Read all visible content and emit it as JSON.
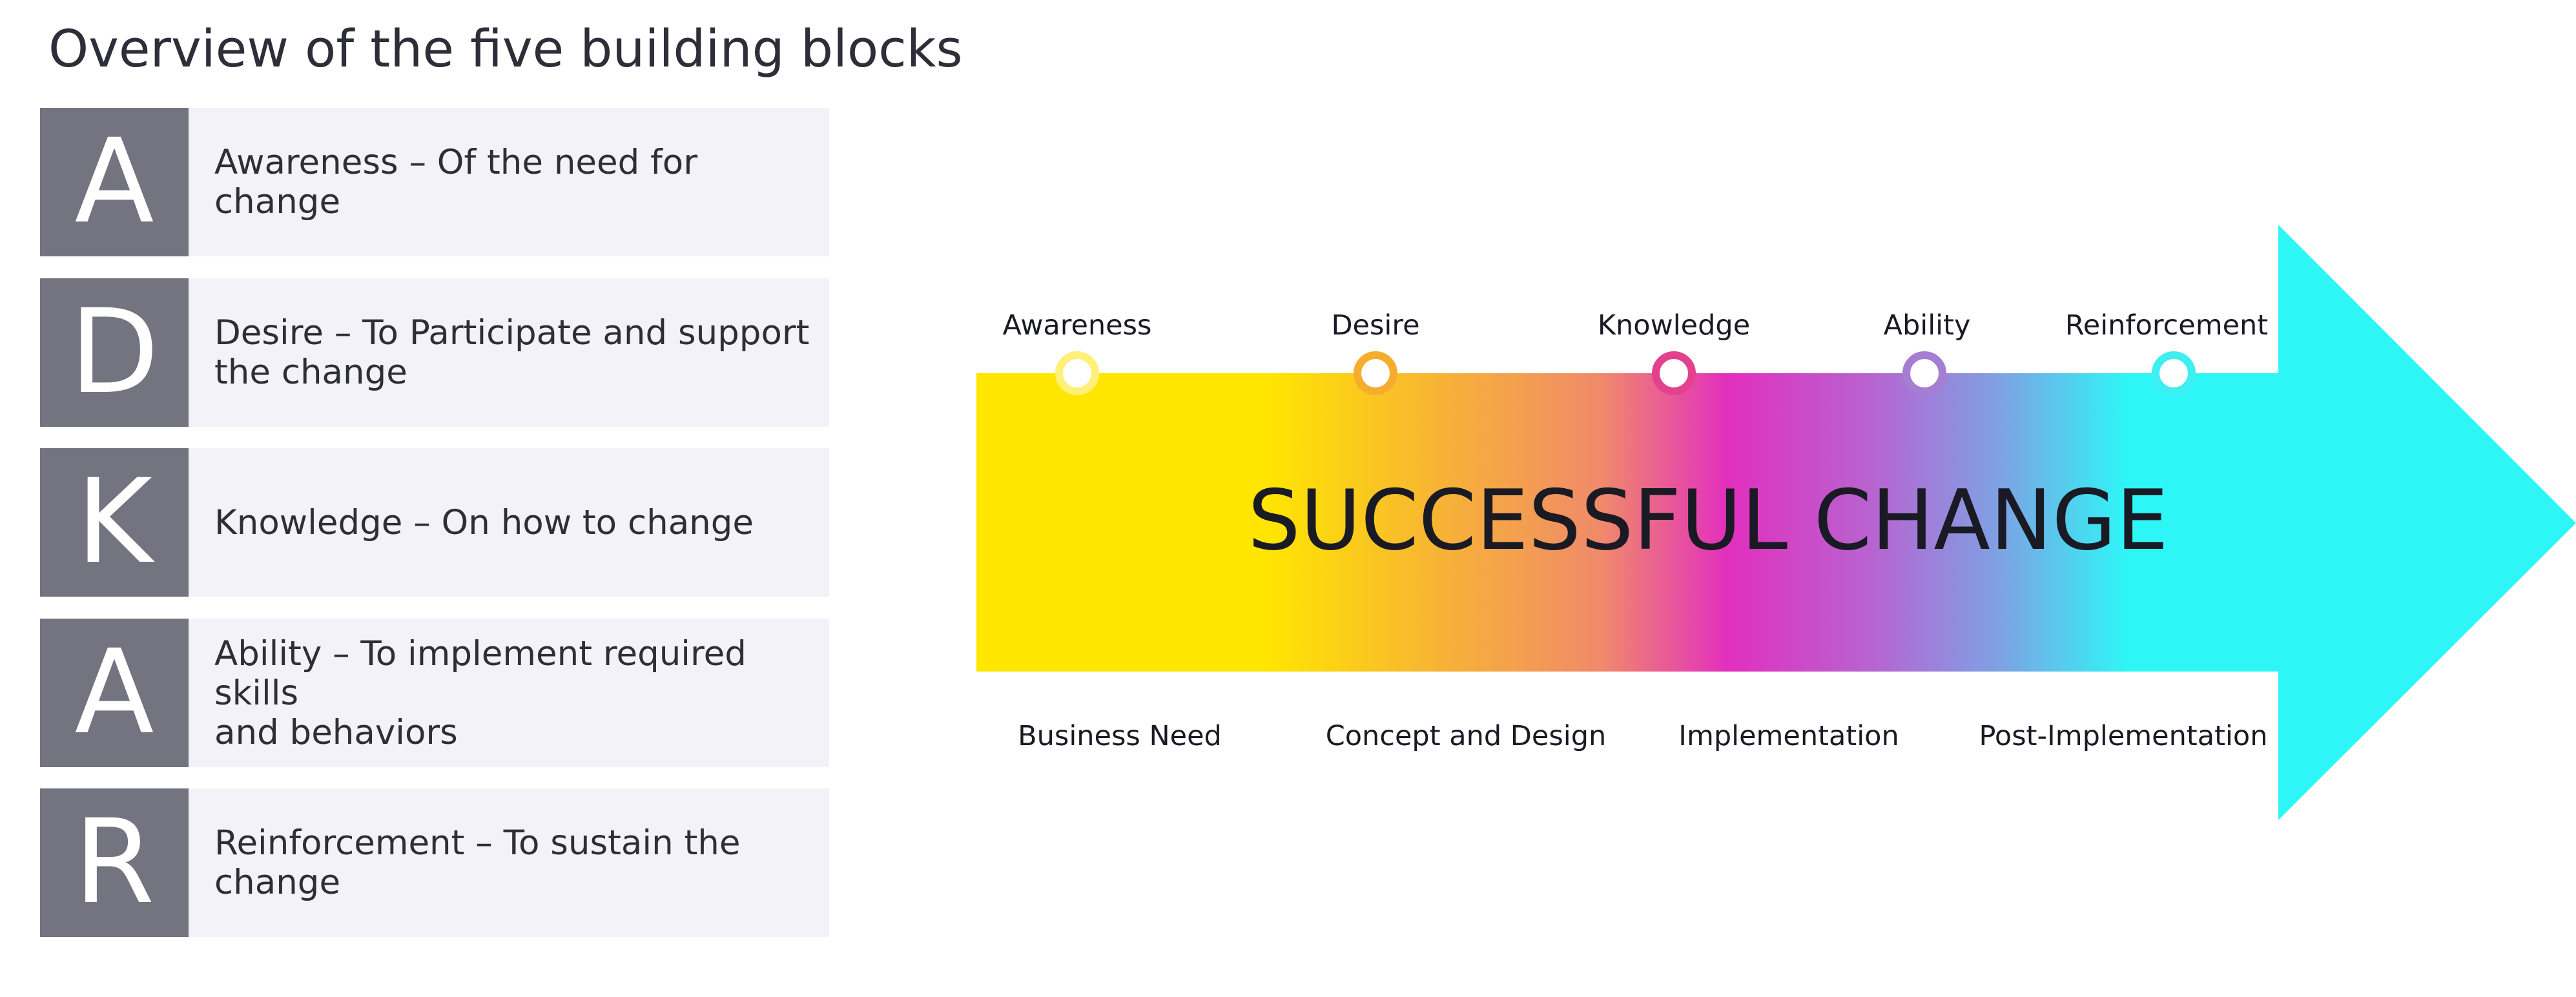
{
  "page": {
    "title": "Overview of the five building blocks"
  },
  "blocks": [
    {
      "letter": "A",
      "lines": [
        "Awareness – Of the need for change"
      ]
    },
    {
      "letter": "D",
      "lines": [
        "Desire – To Participate and support",
        "the change"
      ]
    },
    {
      "letter": "K",
      "lines": [
        "Knowledge – On how to change"
      ]
    },
    {
      "letter": "A",
      "lines": [
        "Ability – To implement required skills",
        "and behaviors"
      ]
    },
    {
      "letter": "R",
      "lines": [
        "Reinforcement – To sustain the",
        "change"
      ]
    }
  ],
  "arrow": {
    "center_text": "SUCCESSFUL CHANGE",
    "stages": [
      {
        "label": "Awareness",
        "color": "#fff07a"
      },
      {
        "label": "Desire",
        "color": "#f6ad2e"
      },
      {
        "label": "Knowledge",
        "color": "#e3418e"
      },
      {
        "label": "Ability",
        "color": "#a57ed1"
      },
      {
        "label": "Reinforcement",
        "color": "#3eeef0"
      }
    ],
    "phases": [
      "Business Need",
      "Concept and Design",
      "Implementation",
      "Post-Implementation"
    ],
    "gradient_colors": [
      "#ffe600",
      "#f7b335",
      "#e22fbe",
      "#7ea2e4",
      "#2ef6f6"
    ]
  },
  "colors": {
    "block_letter_bg": "#747480",
    "block_text_bg": "#f3f2f8",
    "text": "#2e2e38"
  }
}
